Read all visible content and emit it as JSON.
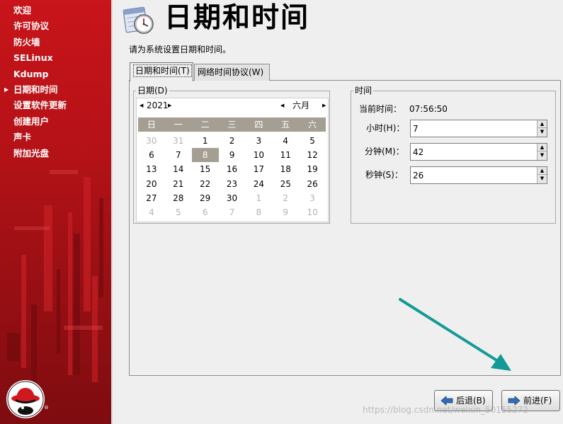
{
  "sidebar": {
    "items": [
      {
        "label": "欢迎",
        "active": false
      },
      {
        "label": "许可协议",
        "active": false
      },
      {
        "label": "防火墙",
        "active": false
      },
      {
        "label": "SELinux",
        "active": false
      },
      {
        "label": "Kdump",
        "active": false
      },
      {
        "label": "日期和时间",
        "active": true
      },
      {
        "label": "设置软件更新",
        "active": false
      },
      {
        "label": "创建用户",
        "active": false
      },
      {
        "label": "声卡",
        "active": false
      },
      {
        "label": "附加光盘",
        "active": false
      }
    ],
    "logo_mark": "®"
  },
  "header": {
    "title": "日期和时间",
    "icon": "calendar-clock-icon",
    "instruction": "请为系统设置日期和时间。"
  },
  "tabs": [
    {
      "label": "日期和时间(T)",
      "selected": true
    },
    {
      "label": "网络时间协议(W)",
      "selected": false
    }
  ],
  "date": {
    "legend": "日期(D)",
    "year": "2021",
    "month": "六月",
    "weekdays": [
      "日",
      "一",
      "二",
      "三",
      "四",
      "五",
      "六"
    ],
    "weeks": [
      [
        {
          "d": "30",
          "o": true
        },
        {
          "d": "31",
          "o": true
        },
        {
          "d": "1"
        },
        {
          "d": "2"
        },
        {
          "d": "3"
        },
        {
          "d": "4"
        },
        {
          "d": "5"
        }
      ],
      [
        {
          "d": "6"
        },
        {
          "d": "7"
        },
        {
          "d": "8",
          "sel": true
        },
        {
          "d": "9"
        },
        {
          "d": "10"
        },
        {
          "d": "11"
        },
        {
          "d": "12"
        }
      ],
      [
        {
          "d": "13"
        },
        {
          "d": "14"
        },
        {
          "d": "15"
        },
        {
          "d": "16"
        },
        {
          "d": "17"
        },
        {
          "d": "18"
        },
        {
          "d": "19"
        }
      ],
      [
        {
          "d": "20"
        },
        {
          "d": "21"
        },
        {
          "d": "22"
        },
        {
          "d": "23"
        },
        {
          "d": "24"
        },
        {
          "d": "25"
        },
        {
          "d": "26"
        }
      ],
      [
        {
          "d": "27"
        },
        {
          "d": "28"
        },
        {
          "d": "29"
        },
        {
          "d": "30"
        },
        {
          "d": "1",
          "o": true
        },
        {
          "d": "2",
          "o": true
        },
        {
          "d": "3",
          "o": true
        }
      ],
      [
        {
          "d": "4",
          "o": true
        },
        {
          "d": "5",
          "o": true
        },
        {
          "d": "6",
          "o": true
        },
        {
          "d": "7",
          "o": true
        },
        {
          "d": "8",
          "o": true
        },
        {
          "d": "9",
          "o": true
        },
        {
          "d": "10",
          "o": true
        }
      ]
    ]
  },
  "time": {
    "legend": "时间",
    "current_label": "当前时间：",
    "current_value": "07:56:50",
    "hour_label": "小时(H)：",
    "hour_value": "7",
    "minute_label": "分钟(M)：",
    "minute_value": "42",
    "second_label": "秒钟(S)：",
    "second_value": "26"
  },
  "buttons": {
    "back": "后退(B)",
    "next": "前进(F)"
  },
  "annotation_color": "#139a96",
  "watermark": "https://blog.csdn.net/weixin_50155272"
}
